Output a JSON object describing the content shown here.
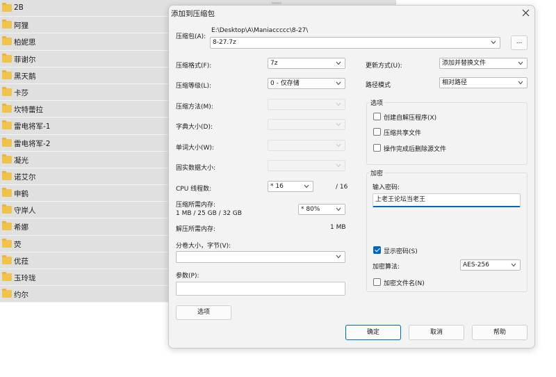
{
  "folders": [
    {
      "name": "2B"
    },
    {
      "name": "阿狸"
    },
    {
      "name": "柏妮思"
    },
    {
      "name": "菲谢尔"
    },
    {
      "name": "黑天鹅"
    },
    {
      "name": "卡莎"
    },
    {
      "name": "坎特蕾拉"
    },
    {
      "name": "雷电将军-1"
    },
    {
      "name": "雷电将军-2"
    },
    {
      "name": "凝光"
    },
    {
      "name": "诺艾尔"
    },
    {
      "name": "申鹤"
    },
    {
      "name": "守岸人"
    },
    {
      "name": "希娜"
    },
    {
      "name": "荧"
    },
    {
      "name": "优菈"
    },
    {
      "name": "玉玲珑"
    },
    {
      "name": "约尔"
    }
  ],
  "dialog": {
    "title": "添加到压缩包",
    "archive_label": "压缩包(A):",
    "archive_path": "E:\\Desktop\\A\\Maniaccccc\\8-27\\",
    "archive_name": "8-27.7z",
    "browse_label": "...",
    "format_label": "压缩格式(F):",
    "format_value": "7z",
    "level_label": "压缩等级(L):",
    "level_value": "0 - 仅存储",
    "method_label": "压缩方法(M):",
    "dict_label": "字典大小(D):",
    "word_label": "单词大小(W):",
    "solid_label": "固实数据大小:",
    "threads_label": "CPU 线程数:",
    "threads_value": "* 16",
    "threads_total": "/ 16",
    "mem_label": "压缩所需内存:",
    "mem_detail": "1 MB / 25 GB / 32 GB",
    "mem_value": "* 80%",
    "decomp_label": "解压所需内存:",
    "decomp_value": "1 MB",
    "split_label": "分卷大小，字节(V):",
    "split_value": "",
    "params_label": "参数(P):",
    "params_value": "",
    "options_button": "选项",
    "update_label": "更新方式(U):",
    "update_value": "添加并替换文件",
    "pathmode_label": "路径模式",
    "pathmode_value": "相对路径",
    "options_group": "选项",
    "opt_sfx": "创建自解压程序(X)",
    "opt_shared": "压缩共享文件",
    "opt_delete": "操作完成后删除源文件",
    "encrypt_group": "加密",
    "password_label": "输入密码:",
    "password_value": "上老王论坛当老王",
    "show_password_label": "显示密码(S)",
    "show_password_checked": true,
    "enc_method_label": "加密算法:",
    "enc_method_value": "AES-256",
    "encrypt_names_label": "加密文件名(N)",
    "ok_button": "确定",
    "cancel_button": "取消",
    "help_button": "帮助"
  },
  "colors": {
    "accent": "#0067c0",
    "folder": "#f2c34a",
    "list_bg": "#e0e0e0",
    "dialog_bg": "#f3f3f3"
  }
}
